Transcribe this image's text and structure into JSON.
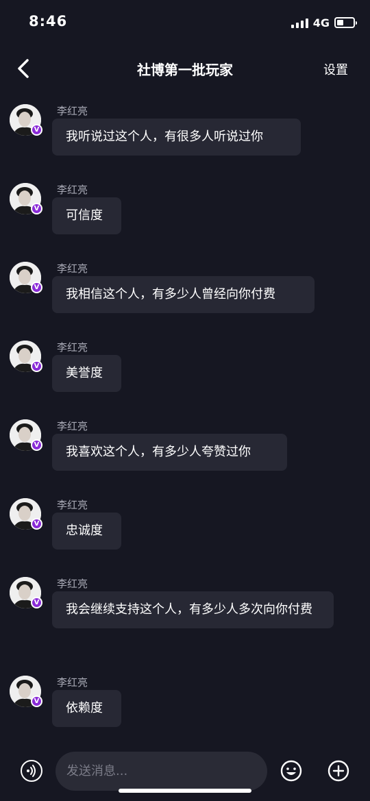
{
  "status": {
    "time": "8:46",
    "network": "4G"
  },
  "nav": {
    "title": "社博第一批玩家",
    "settings_label": "设置"
  },
  "messages": [
    {
      "sender": "李红亮",
      "text": "我听说过这个人，有很多人听说过你"
    },
    {
      "sender": "李红亮",
      "text": "可信度"
    },
    {
      "sender": "李红亮",
      "text": "我相信这个人，有多少人曾经向你付费"
    },
    {
      "sender": "李红亮",
      "text": "美誉度"
    },
    {
      "sender": "李红亮",
      "text": "我喜欢这个人，有多少人夸赞过你"
    },
    {
      "sender": "李红亮",
      "text": "忠诚度"
    },
    {
      "sender": "李红亮",
      "text": "我会继续支持这个人，有多少人多次向你付费"
    },
    {
      "sender": "李红亮",
      "text": "依赖度"
    }
  ],
  "avatar_badge": "V",
  "input": {
    "placeholder": "发送消息..."
  },
  "icons": [
    "back-arrow-icon",
    "voice-icon",
    "emoji-icon",
    "plus-icon"
  ],
  "colors": {
    "background": "#161722",
    "bubble": "#272834",
    "badge": "#8a2bd8"
  }
}
